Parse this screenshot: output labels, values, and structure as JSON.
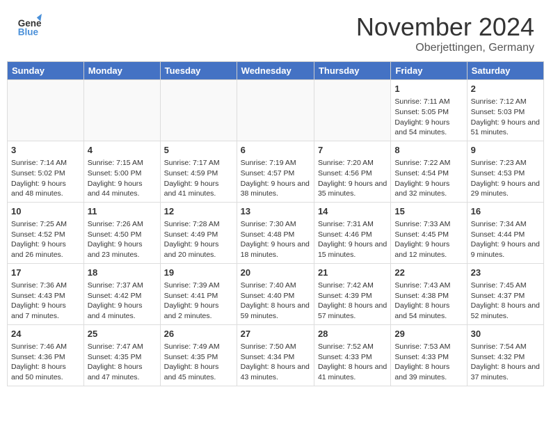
{
  "header": {
    "logo": {
      "general": "General",
      "blue": "Blue"
    },
    "title": "November 2024",
    "location": "Oberjettingen, Germany"
  },
  "weekdays": [
    "Sunday",
    "Monday",
    "Tuesday",
    "Wednesday",
    "Thursday",
    "Friday",
    "Saturday"
  ],
  "weeks": [
    [
      {
        "day": "",
        "info": ""
      },
      {
        "day": "",
        "info": ""
      },
      {
        "day": "",
        "info": ""
      },
      {
        "day": "",
        "info": ""
      },
      {
        "day": "",
        "info": ""
      },
      {
        "day": "1",
        "info": "Sunrise: 7:11 AM\nSunset: 5:05 PM\nDaylight: 9 hours and 54 minutes."
      },
      {
        "day": "2",
        "info": "Sunrise: 7:12 AM\nSunset: 5:03 PM\nDaylight: 9 hours and 51 minutes."
      }
    ],
    [
      {
        "day": "3",
        "info": "Sunrise: 7:14 AM\nSunset: 5:02 PM\nDaylight: 9 hours and 48 minutes."
      },
      {
        "day": "4",
        "info": "Sunrise: 7:15 AM\nSunset: 5:00 PM\nDaylight: 9 hours and 44 minutes."
      },
      {
        "day": "5",
        "info": "Sunrise: 7:17 AM\nSunset: 4:59 PM\nDaylight: 9 hours and 41 minutes."
      },
      {
        "day": "6",
        "info": "Sunrise: 7:19 AM\nSunset: 4:57 PM\nDaylight: 9 hours and 38 minutes."
      },
      {
        "day": "7",
        "info": "Sunrise: 7:20 AM\nSunset: 4:56 PM\nDaylight: 9 hours and 35 minutes."
      },
      {
        "day": "8",
        "info": "Sunrise: 7:22 AM\nSunset: 4:54 PM\nDaylight: 9 hours and 32 minutes."
      },
      {
        "day": "9",
        "info": "Sunrise: 7:23 AM\nSunset: 4:53 PM\nDaylight: 9 hours and 29 minutes."
      }
    ],
    [
      {
        "day": "10",
        "info": "Sunrise: 7:25 AM\nSunset: 4:52 PM\nDaylight: 9 hours and 26 minutes."
      },
      {
        "day": "11",
        "info": "Sunrise: 7:26 AM\nSunset: 4:50 PM\nDaylight: 9 hours and 23 minutes."
      },
      {
        "day": "12",
        "info": "Sunrise: 7:28 AM\nSunset: 4:49 PM\nDaylight: 9 hours and 20 minutes."
      },
      {
        "day": "13",
        "info": "Sunrise: 7:30 AM\nSunset: 4:48 PM\nDaylight: 9 hours and 18 minutes."
      },
      {
        "day": "14",
        "info": "Sunrise: 7:31 AM\nSunset: 4:46 PM\nDaylight: 9 hours and 15 minutes."
      },
      {
        "day": "15",
        "info": "Sunrise: 7:33 AM\nSunset: 4:45 PM\nDaylight: 9 hours and 12 minutes."
      },
      {
        "day": "16",
        "info": "Sunrise: 7:34 AM\nSunset: 4:44 PM\nDaylight: 9 hours and 9 minutes."
      }
    ],
    [
      {
        "day": "17",
        "info": "Sunrise: 7:36 AM\nSunset: 4:43 PM\nDaylight: 9 hours and 7 minutes."
      },
      {
        "day": "18",
        "info": "Sunrise: 7:37 AM\nSunset: 4:42 PM\nDaylight: 9 hours and 4 minutes."
      },
      {
        "day": "19",
        "info": "Sunrise: 7:39 AM\nSunset: 4:41 PM\nDaylight: 9 hours and 2 minutes."
      },
      {
        "day": "20",
        "info": "Sunrise: 7:40 AM\nSunset: 4:40 PM\nDaylight: 8 hours and 59 minutes."
      },
      {
        "day": "21",
        "info": "Sunrise: 7:42 AM\nSunset: 4:39 PM\nDaylight: 8 hours and 57 minutes."
      },
      {
        "day": "22",
        "info": "Sunrise: 7:43 AM\nSunset: 4:38 PM\nDaylight: 8 hours and 54 minutes."
      },
      {
        "day": "23",
        "info": "Sunrise: 7:45 AM\nSunset: 4:37 PM\nDaylight: 8 hours and 52 minutes."
      }
    ],
    [
      {
        "day": "24",
        "info": "Sunrise: 7:46 AM\nSunset: 4:36 PM\nDaylight: 8 hours and 50 minutes."
      },
      {
        "day": "25",
        "info": "Sunrise: 7:47 AM\nSunset: 4:35 PM\nDaylight: 8 hours and 47 minutes."
      },
      {
        "day": "26",
        "info": "Sunrise: 7:49 AM\nSunset: 4:35 PM\nDaylight: 8 hours and 45 minutes."
      },
      {
        "day": "27",
        "info": "Sunrise: 7:50 AM\nSunset: 4:34 PM\nDaylight: 8 hours and 43 minutes."
      },
      {
        "day": "28",
        "info": "Sunrise: 7:52 AM\nSunset: 4:33 PM\nDaylight: 8 hours and 41 minutes."
      },
      {
        "day": "29",
        "info": "Sunrise: 7:53 AM\nSunset: 4:33 PM\nDaylight: 8 hours and 39 minutes."
      },
      {
        "day": "30",
        "info": "Sunrise: 7:54 AM\nSunset: 4:32 PM\nDaylight: 8 hours and 37 minutes."
      }
    ]
  ]
}
